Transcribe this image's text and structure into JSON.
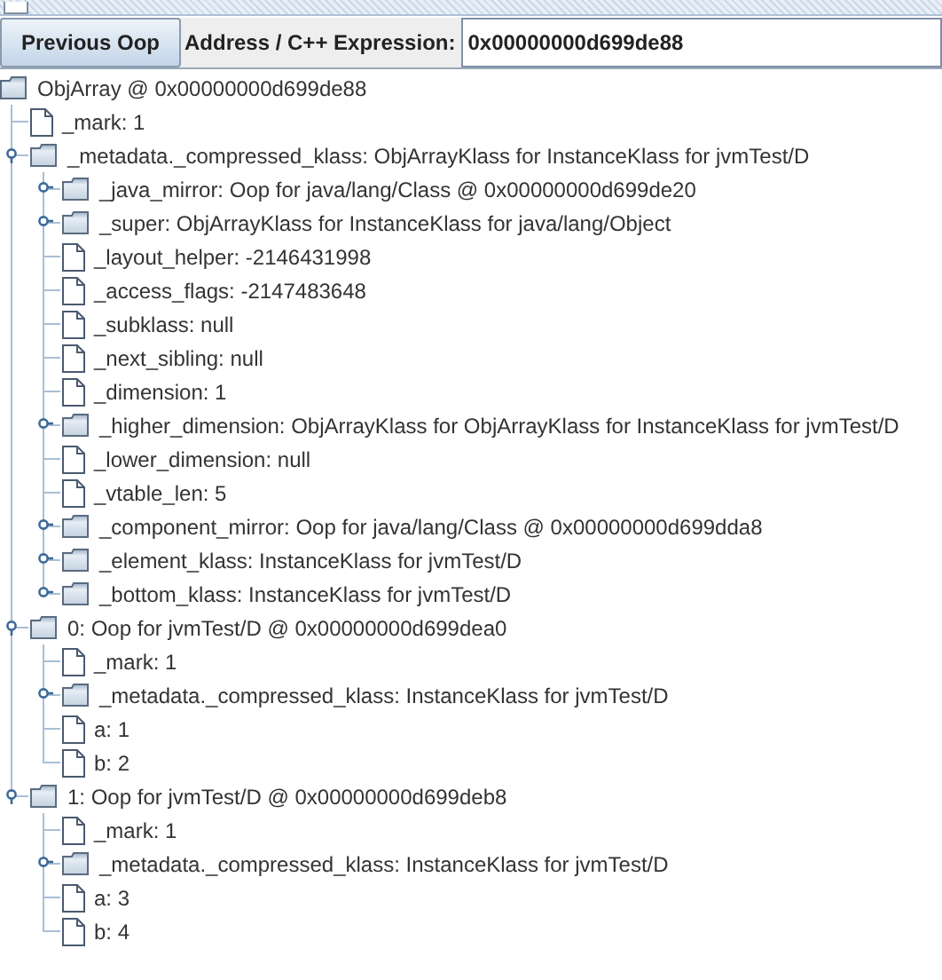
{
  "toolbar": {
    "button": "Previous Oop",
    "address_label": "Address / C++ Expression:",
    "address_value": "0x00000000d699de88"
  },
  "tree": {
    "kind": "folder",
    "label": "ObjArray @ 0x00000000d699de88",
    "expanded": true,
    "children": [
      {
        "kind": "leaf",
        "label": "_mark: 1"
      },
      {
        "kind": "folder",
        "label": "_metadata._compressed_klass: ObjArrayKlass for InstanceKlass for jvmTest/D",
        "expanded": true,
        "children": [
          {
            "kind": "folder",
            "label": "_java_mirror: Oop for java/lang/Class @ 0x00000000d699de20",
            "expanded": false
          },
          {
            "kind": "folder",
            "label": "_super: ObjArrayKlass for InstanceKlass for java/lang/Object",
            "expanded": false
          },
          {
            "kind": "leaf",
            "label": "_layout_helper: -2146431998"
          },
          {
            "kind": "leaf",
            "label": "_access_flags: -2147483648"
          },
          {
            "kind": "leaf",
            "label": "_subklass: null"
          },
          {
            "kind": "leaf",
            "label": "_next_sibling: null"
          },
          {
            "kind": "leaf",
            "label": "_dimension: 1"
          },
          {
            "kind": "folder",
            "label": "_higher_dimension: ObjArrayKlass for ObjArrayKlass for InstanceKlass for jvmTest/D",
            "expanded": false
          },
          {
            "kind": "leaf",
            "label": "_lower_dimension: null"
          },
          {
            "kind": "leaf",
            "label": "_vtable_len: 5"
          },
          {
            "kind": "folder",
            "label": "_component_mirror: Oop for java/lang/Class @ 0x00000000d699dda8",
            "expanded": false
          },
          {
            "kind": "folder",
            "label": "_element_klass: InstanceKlass for jvmTest/D",
            "expanded": false
          },
          {
            "kind": "folder",
            "label": "_bottom_klass: InstanceKlass for jvmTest/D",
            "expanded": false
          }
        ]
      },
      {
        "kind": "folder",
        "label": "0: Oop for jvmTest/D @ 0x00000000d699dea0",
        "expanded": true,
        "children": [
          {
            "kind": "leaf",
            "label": "_mark: 1"
          },
          {
            "kind": "folder",
            "label": "_metadata._compressed_klass: InstanceKlass for jvmTest/D",
            "expanded": false
          },
          {
            "kind": "leaf",
            "label": "a: 1"
          },
          {
            "kind": "leaf",
            "label": "b: 2"
          }
        ]
      },
      {
        "kind": "folder",
        "label": "1: Oop for jvmTest/D @ 0x00000000d699deb8",
        "expanded": true,
        "children": [
          {
            "kind": "leaf",
            "label": "_mark: 1"
          },
          {
            "kind": "folder",
            "label": "_metadata._compressed_klass: InstanceKlass for jvmTest/D",
            "expanded": false
          },
          {
            "kind": "leaf",
            "label": "a: 3"
          },
          {
            "kind": "leaf",
            "label": "b: 4"
          }
        ]
      }
    ]
  }
}
